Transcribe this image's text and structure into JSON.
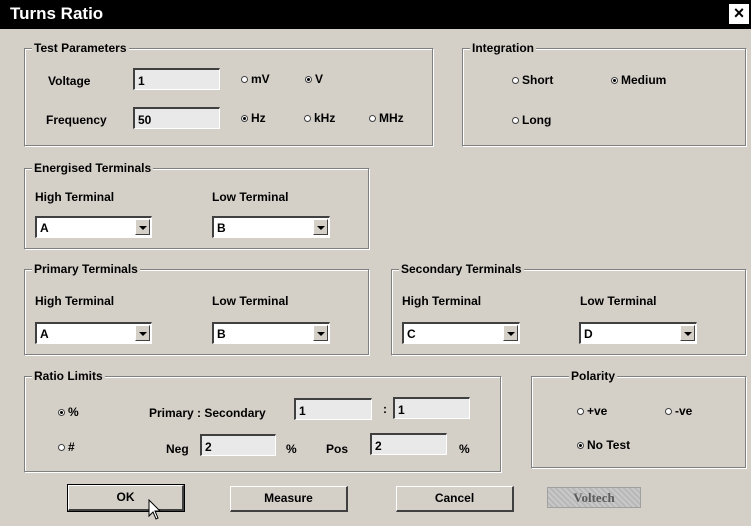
{
  "window": {
    "title": "Turns Ratio",
    "close_glyph": "×"
  },
  "test_parameters": {
    "legend": "Test Parameters",
    "voltage_label": "Voltage",
    "voltage_value": "1",
    "voltage_units": [
      {
        "label": "mV",
        "selected": false
      },
      {
        "label": "V",
        "selected": true
      }
    ],
    "frequency_label": "Frequency",
    "frequency_value": "50",
    "frequency_units": [
      {
        "label": "Hz",
        "selected": true
      },
      {
        "label": "kHz",
        "selected": false
      },
      {
        "label": "MHz",
        "selected": false
      }
    ]
  },
  "integration": {
    "legend": "Integration",
    "options": [
      {
        "label": "Short",
        "selected": false
      },
      {
        "label": "Medium",
        "selected": true
      },
      {
        "label": "Long",
        "selected": false
      }
    ]
  },
  "energised_terminals": {
    "legend": "Energised Terminals",
    "high_label": "High Terminal",
    "high_value": "A",
    "low_label": "Low Terminal",
    "low_value": "B"
  },
  "primary_terminals": {
    "legend": "Primary Terminals",
    "high_label": "High Terminal",
    "high_value": "A",
    "low_label": "Low Terminal",
    "low_value": "B"
  },
  "secondary_terminals": {
    "legend": "Secondary Terminals",
    "high_label": "High Terminal",
    "high_value": "C",
    "low_label": "Low Terminal",
    "low_value": "D"
  },
  "ratio_limits": {
    "legend": "Ratio Limits",
    "mode_options": [
      {
        "label": "%",
        "selected": true
      },
      {
        "label": "#",
        "selected": false
      }
    ],
    "ps_label": "Primary : Secondary",
    "primary_value": "1",
    "colon": ":",
    "secondary_value": "1",
    "neg_label": "Neg",
    "neg_value": "2",
    "neg_unit": "%",
    "pos_label": "Pos",
    "pos_value": "2",
    "pos_unit": "%"
  },
  "polarity": {
    "legend": "Polarity",
    "options": [
      {
        "label": "+ve",
        "selected": false
      },
      {
        "label": "-ve",
        "selected": false
      },
      {
        "label": "No Test",
        "selected": true
      }
    ]
  },
  "buttons": {
    "ok": "OK",
    "measure": "Measure",
    "cancel": "Cancel"
  },
  "logo": {
    "text": "Voltech"
  },
  "icons": {
    "close": "close-icon",
    "combo_arrow": "chevron-down-icon",
    "cursor": "mouse-pointer-icon"
  }
}
